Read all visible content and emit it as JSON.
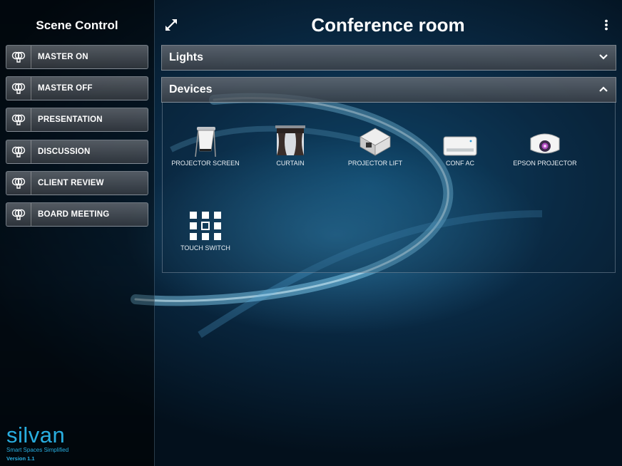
{
  "sidebar": {
    "title": "Scene Control",
    "scenes": [
      {
        "label": "MASTER ON",
        "icon": "bulbs-icon"
      },
      {
        "label": "MASTER OFF",
        "icon": "bulbs-icon"
      },
      {
        "label": "PRESENTATION",
        "icon": "bulbs-icon"
      },
      {
        "label": "DISCUSSION",
        "icon": "bulbs-icon"
      },
      {
        "label": "CLIENT REVIEW",
        "icon": "bulbs-icon"
      },
      {
        "label": "BOARD MEETING",
        "icon": "bulbs-icon"
      }
    ],
    "logo": {
      "word": "silvan",
      "tagline": "Smart Spaces Simplified",
      "version": "Version 1.1"
    }
  },
  "header": {
    "title": "Conference room",
    "expand_icon": "expand-arrows-icon",
    "menu_icon": "vertical-dots-icon"
  },
  "sections": [
    {
      "title": "Lights",
      "expanded": false,
      "chevron": "chevron-down-icon"
    },
    {
      "title": "Devices",
      "expanded": true,
      "chevron": "chevron-up-icon"
    }
  ],
  "devices": [
    {
      "label": "PROJECTOR SCREEN",
      "icon": "projector-screen-icon"
    },
    {
      "label": "CURTAIN",
      "icon": "curtain-icon"
    },
    {
      "label": "PROJECTOR LIFT",
      "icon": "projector-lift-icon"
    },
    {
      "label": "CONF AC",
      "icon": "air-conditioner-icon"
    },
    {
      "label": "EPSON PROJECTOR",
      "icon": "projector-icon"
    },
    {
      "label": "TOUCH SWITCH",
      "icon": "touch-switch-grid-icon"
    }
  ],
  "colors": {
    "brand": "#29aee0",
    "accent_glow": "#5ac8ff"
  }
}
